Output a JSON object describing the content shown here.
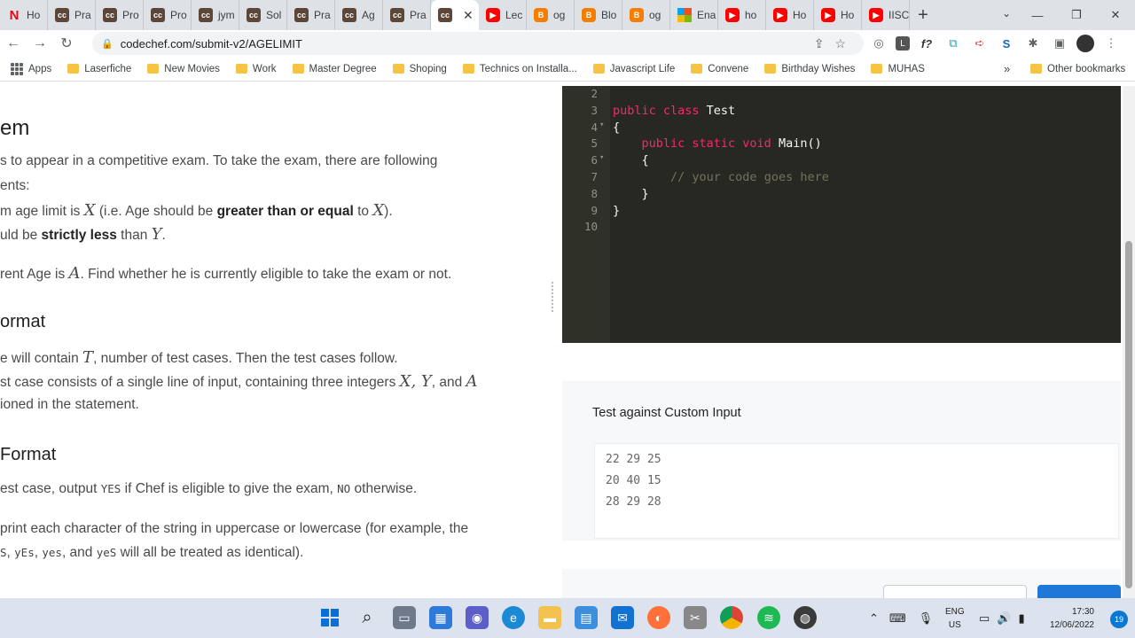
{
  "browser": {
    "tabs": [
      {
        "favicon": "netflix",
        "label": "Ho"
      },
      {
        "favicon": "codechef",
        "label": "Pra"
      },
      {
        "favicon": "codechef",
        "label": "Pro"
      },
      {
        "favicon": "codechef",
        "label": "Pro"
      },
      {
        "favicon": "codechef",
        "label": "jym"
      },
      {
        "favicon": "codechef",
        "label": "Sol"
      },
      {
        "favicon": "codechef",
        "label": "Pra"
      },
      {
        "favicon": "codechef",
        "label": "Ag"
      },
      {
        "favicon": "codechef",
        "label": "Pra"
      },
      {
        "favicon": "codechef",
        "label": "",
        "active": true
      },
      {
        "favicon": "youtube",
        "label": "Lec"
      },
      {
        "favicon": "blogger",
        "label": "og"
      },
      {
        "favicon": "blogger",
        "label": "Blo"
      },
      {
        "favicon": "blogger",
        "label": "og"
      },
      {
        "favicon": "microsoft",
        "label": "Ena"
      },
      {
        "favicon": "youtube",
        "label": "ho"
      },
      {
        "favicon": "youtube",
        "label": "Ho"
      },
      {
        "favicon": "youtube",
        "label": "Ho"
      },
      {
        "favicon": "youtube",
        "label": "IISC"
      }
    ],
    "url": "codechef.com/submit-v2/AGELIMIT",
    "bookmarks": [
      "Apps",
      "Laserfiche",
      "New Movies",
      "Work",
      "Master Degree",
      "Shoping",
      "Technics on Installa...",
      "Javascript Life",
      "Convene",
      "Birthday Wishes",
      "MUHAS"
    ],
    "bookmarks_overflow": "»",
    "other_bookmarks": "Other bookmarks"
  },
  "problem": {
    "heading1": "em",
    "line1": "s to appear in a competitive exam. To take the exam, there are following",
    "line2": "ents:",
    "line3_pre": "m age limit is ",
    "var_x": "X",
    "line3_mid": " (i.e. Age should be ",
    "line3_bold": "greater than or equal",
    "line3_post": " to ",
    "var_x2": "X",
    "line3_end": ").",
    "line4_pre": "uld be ",
    "line4_bold": "strictly less",
    "line4_post": " than ",
    "var_y": "Y",
    "line4_end": ".",
    "line5_pre": "rent Age is ",
    "var_a": "A",
    "line5_post": ". Find whether he is currently eligible to take the exam or not.",
    "heading2": "ormat",
    "line6_pre": "e will contain ",
    "var_t": "T",
    "line6_post": ", number of test cases. Then the test cases follow.",
    "line7_pre": "st case consists of a single line of input, containing three integers ",
    "line7_vars": "X, Y",
    "line7_mid": ", and ",
    "line7_var_a": "A",
    "line8": "ioned in the statement.",
    "heading3": " Format",
    "line9_pre": "est case, output ",
    "line9_code1": "YES",
    "line9_mid": " if Chef is eligible to give the exam, ",
    "line9_code2": "NO",
    "line9_post": " otherwise.",
    "line10": "print each character of the string in uppercase or lowercase (for example, the",
    "line11_code1": "S",
    "line11_sep1": ", ",
    "line11_code2": "yEs",
    "line11_sep2": ", ",
    "line11_code3": "yes",
    "line11_mid": ", and ",
    "line11_code4": "yeS",
    "line11_post": " will all be treated as identical)."
  },
  "editor": {
    "lines": [
      {
        "num": "2",
        "fold": "",
        "indent": "",
        "tokens": []
      },
      {
        "num": "3",
        "fold": "",
        "indent": "",
        "tokens": [
          {
            "t": "public class ",
            "k": "kw"
          },
          {
            "t": "Test",
            "k": ""
          }
        ]
      },
      {
        "num": "4",
        "fold": "▾",
        "indent": "",
        "tokens": [
          {
            "t": "{",
            "k": ""
          }
        ]
      },
      {
        "num": "5",
        "fold": "",
        "indent": "    ",
        "tokens": [
          {
            "t": "public static void ",
            "k": "kw"
          },
          {
            "t": "Main()",
            "k": ""
          }
        ]
      },
      {
        "num": "6",
        "fold": "▾",
        "indent": "    ",
        "tokens": [
          {
            "t": "{",
            "k": ""
          }
        ]
      },
      {
        "num": "7",
        "fold": "",
        "indent": "        ",
        "tokens": [
          {
            "t": "// your code goes here",
            "k": "cm"
          }
        ]
      },
      {
        "num": "8",
        "fold": "",
        "indent": "    ",
        "tokens": [
          {
            "t": "}",
            "k": ""
          }
        ]
      },
      {
        "num": "9",
        "fold": "",
        "indent": "",
        "tokens": [
          {
            "t": "}",
            "k": ""
          }
        ]
      },
      {
        "num": "10",
        "fold": "",
        "indent": "",
        "tokens": []
      }
    ]
  },
  "custom": {
    "title": "Test against Custom Input",
    "input_lines": [
      "22 29 25",
      "20 40 15",
      "28 29 28"
    ]
  },
  "taskbar": {
    "lang_top": "ENG",
    "lang_bottom": "US",
    "time": "17:30",
    "date": "12/06/2022",
    "notifications": "19"
  }
}
